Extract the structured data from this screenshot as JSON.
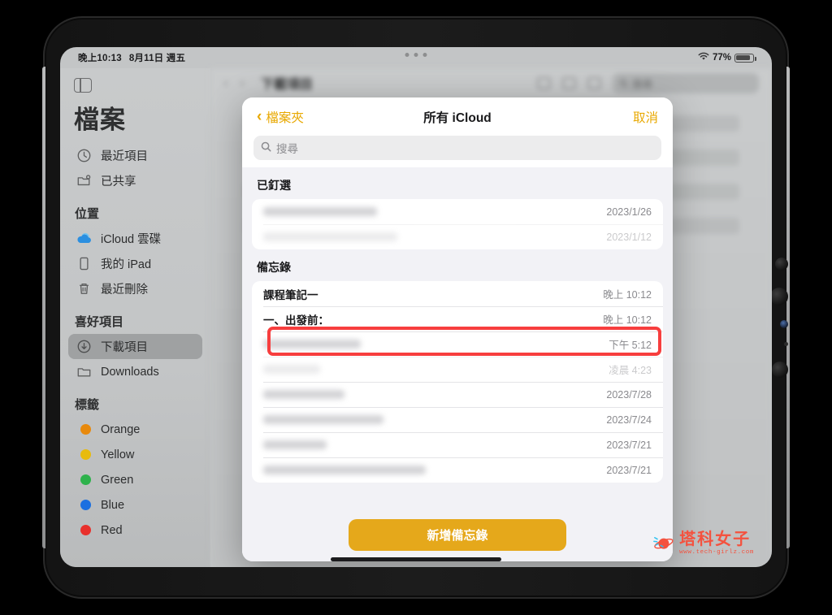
{
  "status_bar": {
    "time": "晚上10:13",
    "date": "8月11日 週五",
    "wifi_icon": "wifi-icon",
    "battery_percent": "77%",
    "battery_icon": "battery-icon"
  },
  "sidebar": {
    "toggle_icon": "sidebar-toggle-icon",
    "app_title": "檔案",
    "top_items": [
      {
        "label": "最近項目",
        "icon": "clock-icon"
      },
      {
        "label": "已共享",
        "icon": "shared-folder-icon"
      }
    ],
    "groups": [
      {
        "title": "位置",
        "items": [
          {
            "label": "iCloud 雲碟",
            "icon": "icloud-icon"
          },
          {
            "label": "我的 iPad",
            "icon": "ipad-icon"
          },
          {
            "label": "最近刪除",
            "icon": "trash-icon"
          }
        ]
      },
      {
        "title": "喜好項目",
        "items": [
          {
            "label": "下載項目",
            "icon": "download-circle-icon",
            "selected": true
          },
          {
            "label": "Downloads",
            "icon": "folder-icon",
            "selected": false
          }
        ]
      },
      {
        "title": "標籤",
        "items": [
          {
            "label": "Orange",
            "icon": "tag-dot-icon",
            "color": "#e8890c"
          },
          {
            "label": "Yellow",
            "icon": "tag-dot-icon",
            "color": "#e8bb0c"
          },
          {
            "label": "Green",
            "icon": "tag-dot-icon",
            "color": "#2eb24c"
          },
          {
            "label": "Blue",
            "icon": "tag-dot-icon",
            "color": "#1a6fe0"
          },
          {
            "label": "Red",
            "icon": "tag-dot-icon",
            "color": "#e8302c"
          }
        ]
      }
    ]
  },
  "background_app": {
    "title": "下載項目",
    "search_placeholder": "搜尋",
    "search_icon": "search-icon"
  },
  "notes_sheet": {
    "back_label": "檔案夾",
    "back_icon": "chevron-left-icon",
    "title": "所有 iCloud",
    "cancel_label": "取消",
    "search_placeholder": "搜尋",
    "search_icon": "search-icon",
    "sections": [
      {
        "title": "已釘選",
        "rows": [
          {
            "name": "",
            "date": "2023/1/26",
            "blurred": true,
            "faded": false
          },
          {
            "name": "",
            "date": "2023/1/12",
            "blurred": true,
            "faded": true
          }
        ]
      },
      {
        "title": "備忘錄",
        "rows": [
          {
            "name": "課程筆記一",
            "date": "晚上 10:12",
            "blurred": false,
            "faded": false,
            "highlighted": true
          },
          {
            "name": "一、出發前：",
            "date": "晚上 10:12",
            "blurred": false,
            "faded": false
          },
          {
            "name": "",
            "date": "下午 5:12",
            "blurred": true,
            "faded": false
          },
          {
            "name": "",
            "date": "凌晨 4:23",
            "blurred": true,
            "faded": true
          },
          {
            "name": "",
            "date": "2023/7/28",
            "blurred": true,
            "faded": false
          },
          {
            "name": "",
            "date": "2023/7/24",
            "blurred": true,
            "faded": false
          },
          {
            "name": "",
            "date": "2023/7/21",
            "blurred": true,
            "faded": false
          },
          {
            "name": "",
            "date": "2023/7/21",
            "blurred": true,
            "faded": false
          }
        ]
      }
    ],
    "add_note_label": "新增備忘錄",
    "highlight_color": "#f73e3e",
    "accent_color": "#e8a800",
    "button_color": "#e5a81b"
  },
  "watermark": {
    "brand": "塔科女子",
    "url": "www.tech-girlz.com",
    "color": "#f4523f"
  }
}
